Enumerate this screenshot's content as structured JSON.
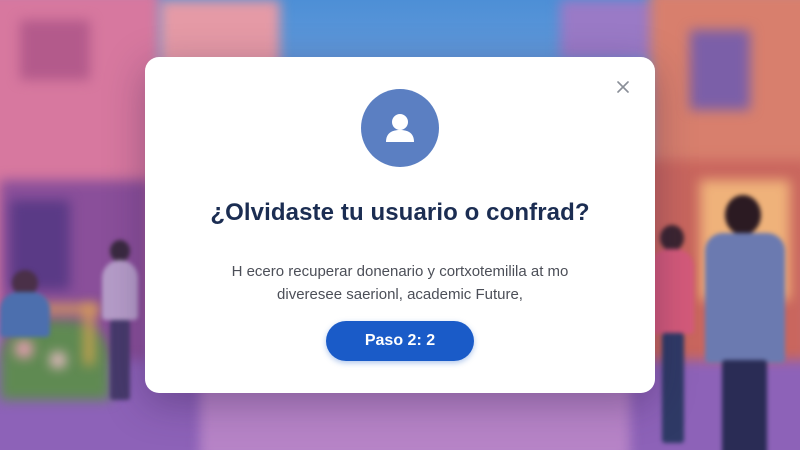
{
  "background": {
    "scene": "campus-street-illustration",
    "colors": {
      "sky": "#4d8fd6",
      "building_left": "#d7789f",
      "building_right": "#d87f6d",
      "ground": "#8d62b8"
    }
  },
  "modal": {
    "close_icon": "close-icon",
    "avatar_icon": "user-icon",
    "avatar_color": "#5b7fc2",
    "title": "¿Olvidaste tu usuario o confrad?",
    "description_line1": "H ecero recuperar donenario y cortxotemilila at mo",
    "description_line2": "diveresee saerionl, academic Future,",
    "step_button_label": "Paso 2: 2",
    "accent_color": "#1a5bc8"
  }
}
